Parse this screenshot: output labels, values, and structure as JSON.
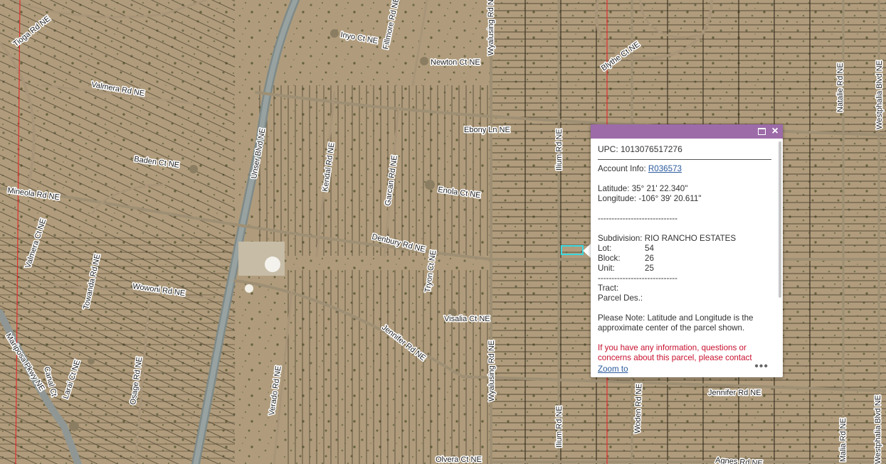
{
  "map": {
    "roads": [
      {
        "id": "tioga",
        "label": "Tioga Rd NE"
      },
      {
        "id": "valmera-top",
        "label": "Valmera Rd NE"
      },
      {
        "id": "inyo",
        "label": "Inyo Ct NE"
      },
      {
        "id": "fillmore",
        "label": "Fillmore Rd NE"
      },
      {
        "id": "newton",
        "label": "Newton Ct NE"
      },
      {
        "id": "wyalusing-top",
        "label": "Wyalusing Rd NE"
      },
      {
        "id": "blythe",
        "label": "Blythe Ct NE"
      },
      {
        "id": "natalie",
        "label": "Natalie Rd NE"
      },
      {
        "id": "westphalia",
        "label": "Westphalia Blvd NE"
      },
      {
        "id": "ebony",
        "label": "Ebony Ln NE"
      },
      {
        "id": "ilium-top",
        "label": "Ilium Rd NE"
      },
      {
        "id": "unser",
        "label": "Unser Blvd NE"
      },
      {
        "id": "kendal",
        "label": "Kendal Rd NE"
      },
      {
        "id": "garcan",
        "label": "Garcan Rd NE"
      },
      {
        "id": "baden",
        "label": "Baden Ct NE"
      },
      {
        "id": "enola",
        "label": "Enola Ct NE"
      },
      {
        "id": "mineola",
        "label": "Mineola Rd NE"
      },
      {
        "id": "valmera-ct",
        "label": "Valmera Ct NE"
      },
      {
        "id": "denbury",
        "label": "Denbury Rd NE"
      },
      {
        "id": "tryon",
        "label": "Tryon Ct NE"
      },
      {
        "id": "towanda",
        "label": "Towanda Rd NE"
      },
      {
        "id": "wowoni",
        "label": "Wowoni Rd NE"
      },
      {
        "id": "visalia",
        "label": "Visalia Ct NE"
      },
      {
        "id": "mariposa",
        "label": "Mariposa Pkwy NE"
      },
      {
        "id": "canal",
        "label": "Canal Ct"
      },
      {
        "id": "larai",
        "label": "Larai Ct NE"
      },
      {
        "id": "osage",
        "label": "Osage Rd NE"
      },
      {
        "id": "verado",
        "label": "Verado Rd NE"
      },
      {
        "id": "jennifer-diag",
        "label": "Jennifer Rd NE"
      },
      {
        "id": "wyalusing-bot",
        "label": "Wyalusing Rd NE"
      },
      {
        "id": "ilium-bot",
        "label": "Ilium Rd NE"
      },
      {
        "id": "woden",
        "label": "Woden Rd NE"
      },
      {
        "id": "jennifer-h",
        "label": "Jennifer Rd NE"
      },
      {
        "id": "westphalia-bot",
        "label": "Westphalia Blvd NE"
      },
      {
        "id": "malia",
        "label": "Malia Rd NE"
      },
      {
        "id": "olvera",
        "label": "Olvera Ct NE"
      },
      {
        "id": "agnes",
        "label": "Agnes Rd NE"
      }
    ],
    "colors": {
      "ground": "#b09c7c",
      "road": "#8a8a82",
      "parcel_line": "#3a3222",
      "boundary": "#e03030",
      "selected_parcel": "#3ad8e0"
    }
  },
  "popup": {
    "header_color": "#9c6ba8",
    "maximize_icon": "maximize-icon",
    "close_icon": "×",
    "upc": "UPC: 1013076517276",
    "account_label": "Account Info:",
    "account_link": "R036573",
    "latitude": "Latitude: 35° 21' 22.340\"",
    "longitude": "Longitude: -106° 39' 20.611\"",
    "separator1": "-----------------------------",
    "subdivision": "Subdivision: RIO RANCHO ESTATES",
    "lot_label": "Lot:",
    "lot_value": "54",
    "block_label": "Block:",
    "block_value": "26",
    "unit_label": "Unit:",
    "unit_value": "25",
    "separator2": "-----------------------------",
    "tract": "Tract:",
    "parcel_des": "Parcel Des.:",
    "note_line1": "Please Note: Latitude and Longitude is the",
    "note_line2": "approximate center of the parcel shown.",
    "contact_line1": "If you have any information, questions or",
    "contact_line2": "concerns about this parcel, please contact",
    "zoom_to": "Zoom to",
    "more_icon": "•••"
  }
}
